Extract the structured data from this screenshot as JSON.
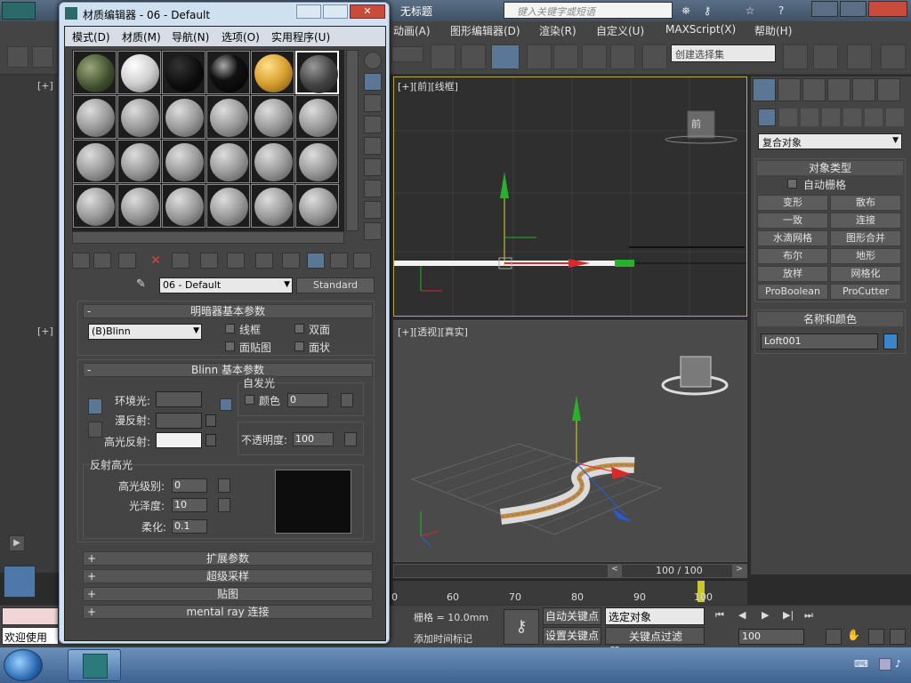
{
  "app": {
    "title": "无标题",
    "search_placeholder": "键入关键字或短语",
    "menu": [
      "动画(A)",
      "图形编辑器(D)",
      "渲染(R)",
      "自定义(U)",
      "MAXScript(X)",
      "帮助(H)"
    ],
    "selection_set": "创建选择集"
  },
  "material_editor": {
    "title": "材质编辑器 - 06 - Default",
    "menu": [
      "模式(D)",
      "材质(M)",
      "导航(N)",
      "选项(O)",
      "实用程序(U)"
    ],
    "material_name": "06 - Default",
    "material_type": "Standard",
    "shader_rollout": "明暗器基本参数",
    "shader_type": "(B)Blinn",
    "wire_label": "线框",
    "two_sided_label": "双面",
    "face_map_label": "面贴图",
    "faceted_label": "面状",
    "blinn_rollout": "Blinn 基本参数",
    "ambient_label": "环境光:",
    "diffuse_label": "漫反射:",
    "specular_label": "高光反射:",
    "self_illum_label": "自发光",
    "color_label": "颜色",
    "self_illum_value": "0",
    "opacity_label": "不透明度:",
    "opacity_value": "100",
    "specular_highlights_label": "反射高光",
    "spec_level_label": "高光级别:",
    "spec_level_value": "0",
    "glossiness_label": "光泽度:",
    "glossiness_value": "10",
    "soften_label": "柔化:",
    "soften_value": "0.1",
    "rollouts_collapsed": [
      "扩展参数",
      "超级采样",
      "贴图",
      "mental ray 连接"
    ],
    "collapse_sign": "-",
    "expand_sign": "+"
  },
  "viewports": {
    "front_label": "[+][前][线框]",
    "perspective_label": "[+][透视][真实]",
    "left_label": "[+]",
    "nav_cube_front": "前",
    "time_slider": "100 / 100",
    "ruler_ticks": [
      "0",
      "60",
      "70",
      "80",
      "90",
      "100"
    ]
  },
  "command_panel": {
    "category": "复合对象",
    "object_type_rollout": "对象类型",
    "autogrid_label": "自动栅格",
    "buttons": [
      "变形",
      "散布",
      "一致",
      "连接",
      "水滴网格",
      "图形合并",
      "布尔",
      "地形",
      "放样",
      "网格化",
      "ProBoolean",
      "ProCutter"
    ],
    "name_color_rollout": "名称和颜色",
    "object_name": "Loft001",
    "object_color": "#3a86c8"
  },
  "status": {
    "grid": "栅格 = 10.0mm",
    "auto_key": "自动关键点",
    "selected_object": "选定对象",
    "set_key": "设置关键点",
    "key_filters": "关键点过滤器...",
    "add_time_tag": "添加时间标记",
    "welcome": "欢迎使用",
    "frame": "100"
  },
  "colors": {
    "viewport_front_bg": "#2f2f2f",
    "viewport_persp_bg": "#4a4a4a",
    "accent_yellow": "#c8a848"
  }
}
